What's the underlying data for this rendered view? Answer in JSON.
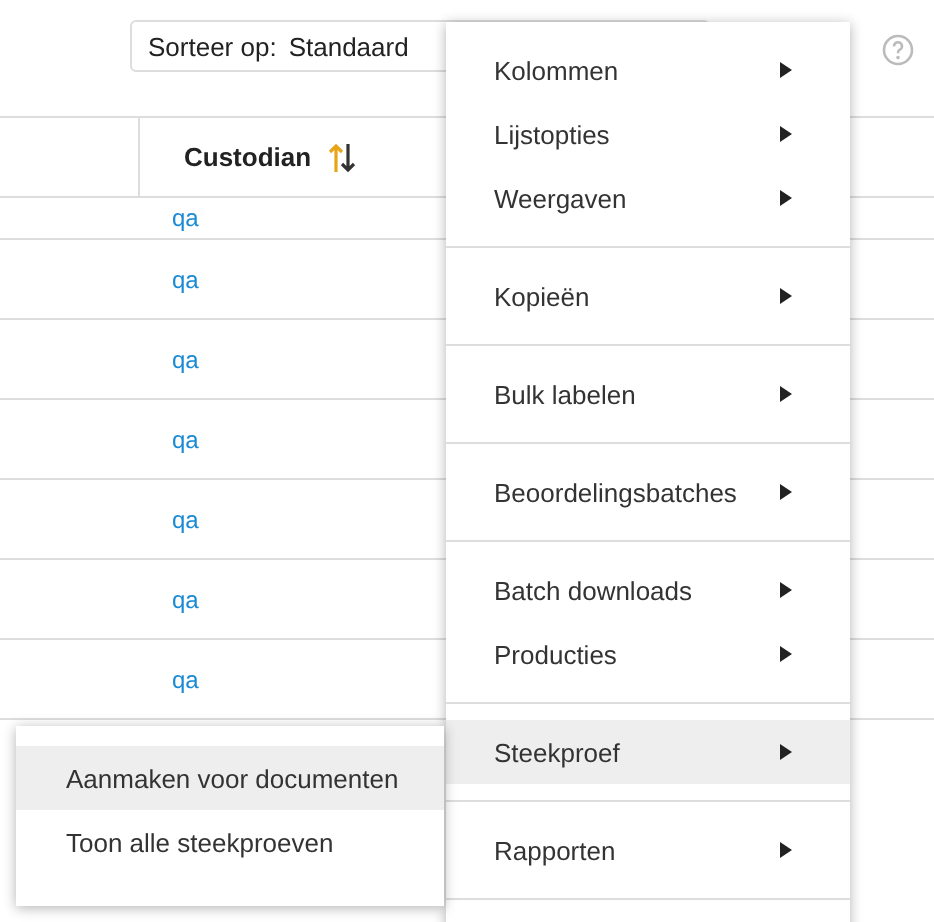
{
  "sort": {
    "label": "Sorteer op:",
    "value": "Standaard"
  },
  "table": {
    "columns": [
      {
        "label": "Custodian"
      }
    ],
    "rows": [
      "qa",
      "qa",
      "qa",
      "qa",
      "qa",
      "qa",
      "qa"
    ]
  },
  "menu": {
    "groups": [
      [
        {
          "label": "Kolommen",
          "has_submenu": true,
          "selected": false
        },
        {
          "label": "Lijstopties",
          "has_submenu": true,
          "selected": false
        },
        {
          "label": "Weergaven",
          "has_submenu": true,
          "selected": false
        }
      ],
      [
        {
          "label": "Kopieën",
          "has_submenu": true,
          "selected": false
        }
      ],
      [
        {
          "label": "Bulk labelen",
          "has_submenu": true,
          "selected": false
        }
      ],
      [
        {
          "label": "Beoordelingsbatches",
          "has_submenu": true,
          "selected": false
        }
      ],
      [
        {
          "label": "Batch downloads",
          "has_submenu": true,
          "selected": false
        },
        {
          "label": "Producties",
          "has_submenu": true,
          "selected": false
        }
      ],
      [
        {
          "label": "Steekproef",
          "has_submenu": true,
          "selected": true
        }
      ],
      [
        {
          "label": "Rapporten",
          "has_submenu": true,
          "selected": false
        }
      ]
    ]
  },
  "submenu": {
    "items": [
      {
        "label": "Aanmaken voor documenten",
        "selected": true
      },
      {
        "label": "Toon alle steekproeven",
        "selected": false
      }
    ]
  }
}
